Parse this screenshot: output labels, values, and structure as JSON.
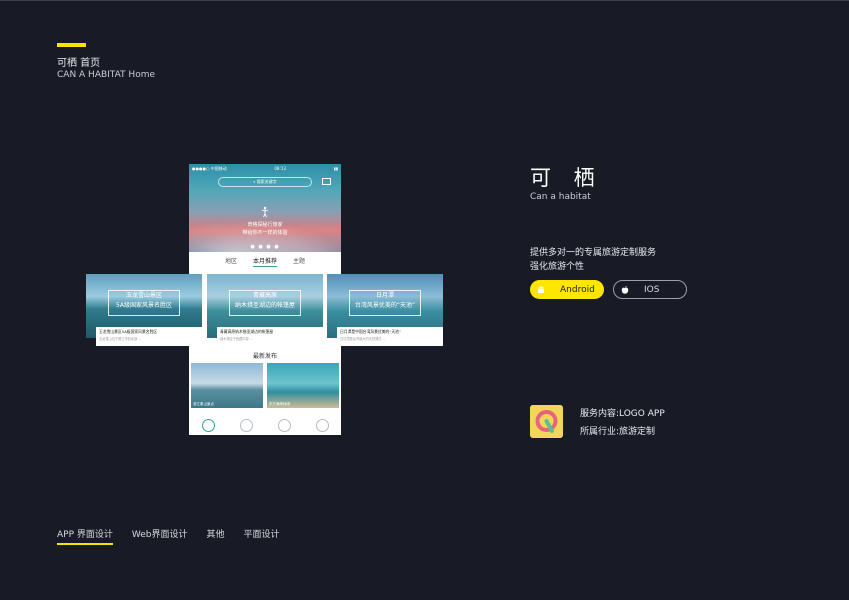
{
  "header": {
    "title_cn": "可栖 首页",
    "title_en": "CAN A HABITAT Home"
  },
  "phone": {
    "status": {
      "carrier": "●●●●○ 中国移动",
      "time": "08:13"
    },
    "search_placeholder": "搜索关键字",
    "hero_line1": "奇格探秘行旅家",
    "hero_line2": "带给你不一样的体验",
    "dots": "● ● ● ●",
    "tabs": [
      "地区",
      "本月推荐",
      "主题"
    ],
    "latest_title": "最新发布",
    "thumbs": [
      "浙江象山景点",
      "东方海岸休闲"
    ]
  },
  "cards": [
    {
      "line1": "玉龙雪山景区",
      "line2": "5A级国家风景名胜区",
      "caption_title": "玉龙雪山景区5A级国家风景名胜区",
      "caption_desc": "玉龙雪山位于丽江市西北部 ..."
    },
    {
      "line1": "青藏高原",
      "line2": "纳木措圣湖边的帐篷屋",
      "caption_title": "青藏高原纳木措圣湖边的帐篷屋",
      "caption_desc": "纳木措位于西藏中部 ..."
    },
    {
      "line1": "日月潭",
      "line2": "台湾风景优美的“天池”",
      "caption_title": "日月潭是中国台湾风景优美的“天池”",
      "caption_desc": "日月潭是台湾最大的天然湖泊 ..."
    }
  ],
  "brand": {
    "name_cn": "可 栖",
    "name_en": "Can a habitat"
  },
  "description": {
    "line1": "提供多对一的专属旅游定制服务",
    "line2": "强化旅游个性"
  },
  "buttons": {
    "android": "Android",
    "ios": "IOS"
  },
  "info": {
    "service": "服务内容:LOGO  APP",
    "industry": "所属行业:旅游定制"
  },
  "bottom_nav": [
    "APP 界面设计",
    "Web界面设计",
    "其他",
    "平面设计"
  ],
  "colors": {
    "accent": "#f5e400",
    "background": "#181b25",
    "android_button": "#ffe600",
    "tab_underline": "#3aa489"
  },
  "icons": [
    "android-icon",
    "apple-icon",
    "home-icon",
    "compass-icon",
    "message-icon",
    "user-icon",
    "search-icon",
    "message-box-icon"
  ]
}
